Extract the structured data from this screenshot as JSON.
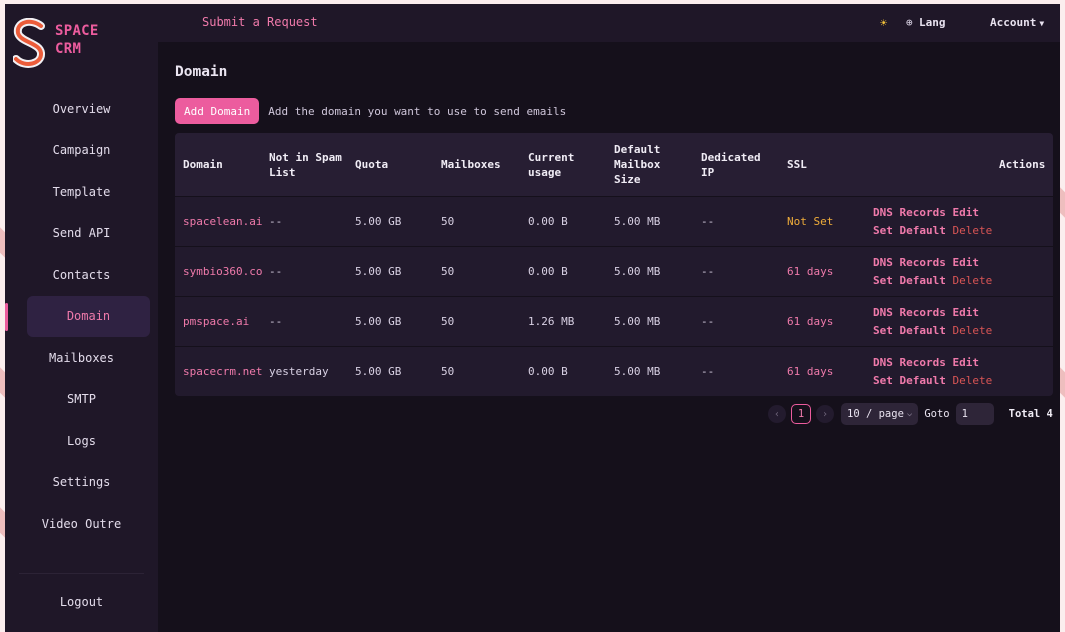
{
  "brand": {
    "line1": "SPACE",
    "line2": "CRM",
    "logo_icon": "s-logo-icon"
  },
  "sidebar": {
    "items": [
      {
        "label": "Overview"
      },
      {
        "label": "Campaign"
      },
      {
        "label": "Template"
      },
      {
        "label": "Send API"
      },
      {
        "label": "Contacts"
      },
      {
        "label": "Domain",
        "active": true
      },
      {
        "label": "Mailboxes"
      },
      {
        "label": "SMTP"
      },
      {
        "label": "Logs"
      },
      {
        "label": "Settings"
      },
      {
        "label": "Video Outre"
      }
    ],
    "logout_label": "Logout"
  },
  "topbar": {
    "submit_label": "Submit a Request",
    "theme_icon": "sun-icon",
    "lang_icon": "globe-icon",
    "lang_label": "Lang",
    "account_label": "Account"
  },
  "page": {
    "title": "Domain",
    "add_button": "Add Domain",
    "helper_text": "Add the domain you want to use to send emails"
  },
  "table": {
    "headers": [
      "Domain",
      "Not in Spam\nList",
      "Quota",
      "Mailboxes",
      "Current\nusage",
      "Default\nMailbox\nSize",
      "Dedicated\nIP",
      "SSL",
      "Actions"
    ],
    "rows": [
      {
        "domain": "spacelean.ai",
        "spam": "--",
        "quota": "5.00 GB",
        "mailboxes": "50",
        "usage": "0.00 B",
        "mbsize": "5.00 MB",
        "ip": "--",
        "ssl": "Not Set"
      },
      {
        "domain": "symbio360.co",
        "spam": "--",
        "quota": "5.00 GB",
        "mailboxes": "50",
        "usage": "0.00 B",
        "mbsize": "5.00 MB",
        "ip": "--",
        "ssl": "61 days"
      },
      {
        "domain": "pmspace.ai",
        "spam": "--",
        "quota": "5.00 GB",
        "mailboxes": "50",
        "usage": "1.26 MB",
        "mbsize": "5.00 MB",
        "ip": "--",
        "ssl": "61 days"
      },
      {
        "domain": "spacecrm.net",
        "spam": "yesterday",
        "quota": "5.00 GB",
        "mailboxes": "50",
        "usage": "0.00 B",
        "mbsize": "5.00 MB",
        "ip": "--",
        "ssl": "61 days"
      }
    ],
    "actions": {
      "dns": "DNS Records",
      "edit": "Edit",
      "set_default": "Set Default",
      "delete": "Delete"
    }
  },
  "pagination": {
    "current_page": "1",
    "page_size": "10 / page",
    "goto_label": "Goto",
    "goto_value": "1",
    "total": "Total 4"
  },
  "colors": {
    "accent": "#ec5c9e",
    "warning": "#f0ad3a",
    "danger": "#d95555"
  }
}
